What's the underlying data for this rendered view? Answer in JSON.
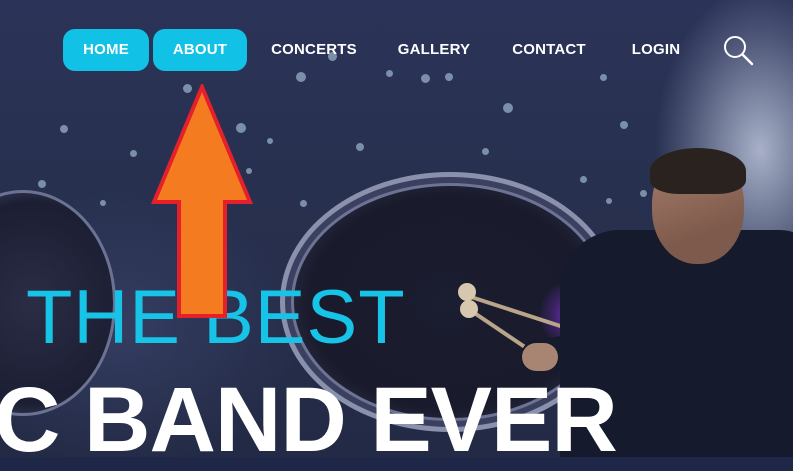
{
  "nav": {
    "items": [
      {
        "label": "HOME",
        "active": true
      },
      {
        "label": "ABOUT",
        "active": true
      },
      {
        "label": "CONCERTS",
        "active": false
      },
      {
        "label": "GALLERY",
        "active": false
      },
      {
        "label": "CONTACT",
        "active": false
      },
      {
        "label": "LOGIN",
        "active": false
      }
    ],
    "search_icon": "search-icon"
  },
  "hero": {
    "headline_line1": "THE BEST",
    "headline_line2": "C BAND EVER"
  },
  "annotation": {
    "arrow_color": "#f47b20",
    "arrow_outline": "#e5202b"
  },
  "colors": {
    "accent": "#12c2e6",
    "headline_accent": "#17c3e6"
  }
}
